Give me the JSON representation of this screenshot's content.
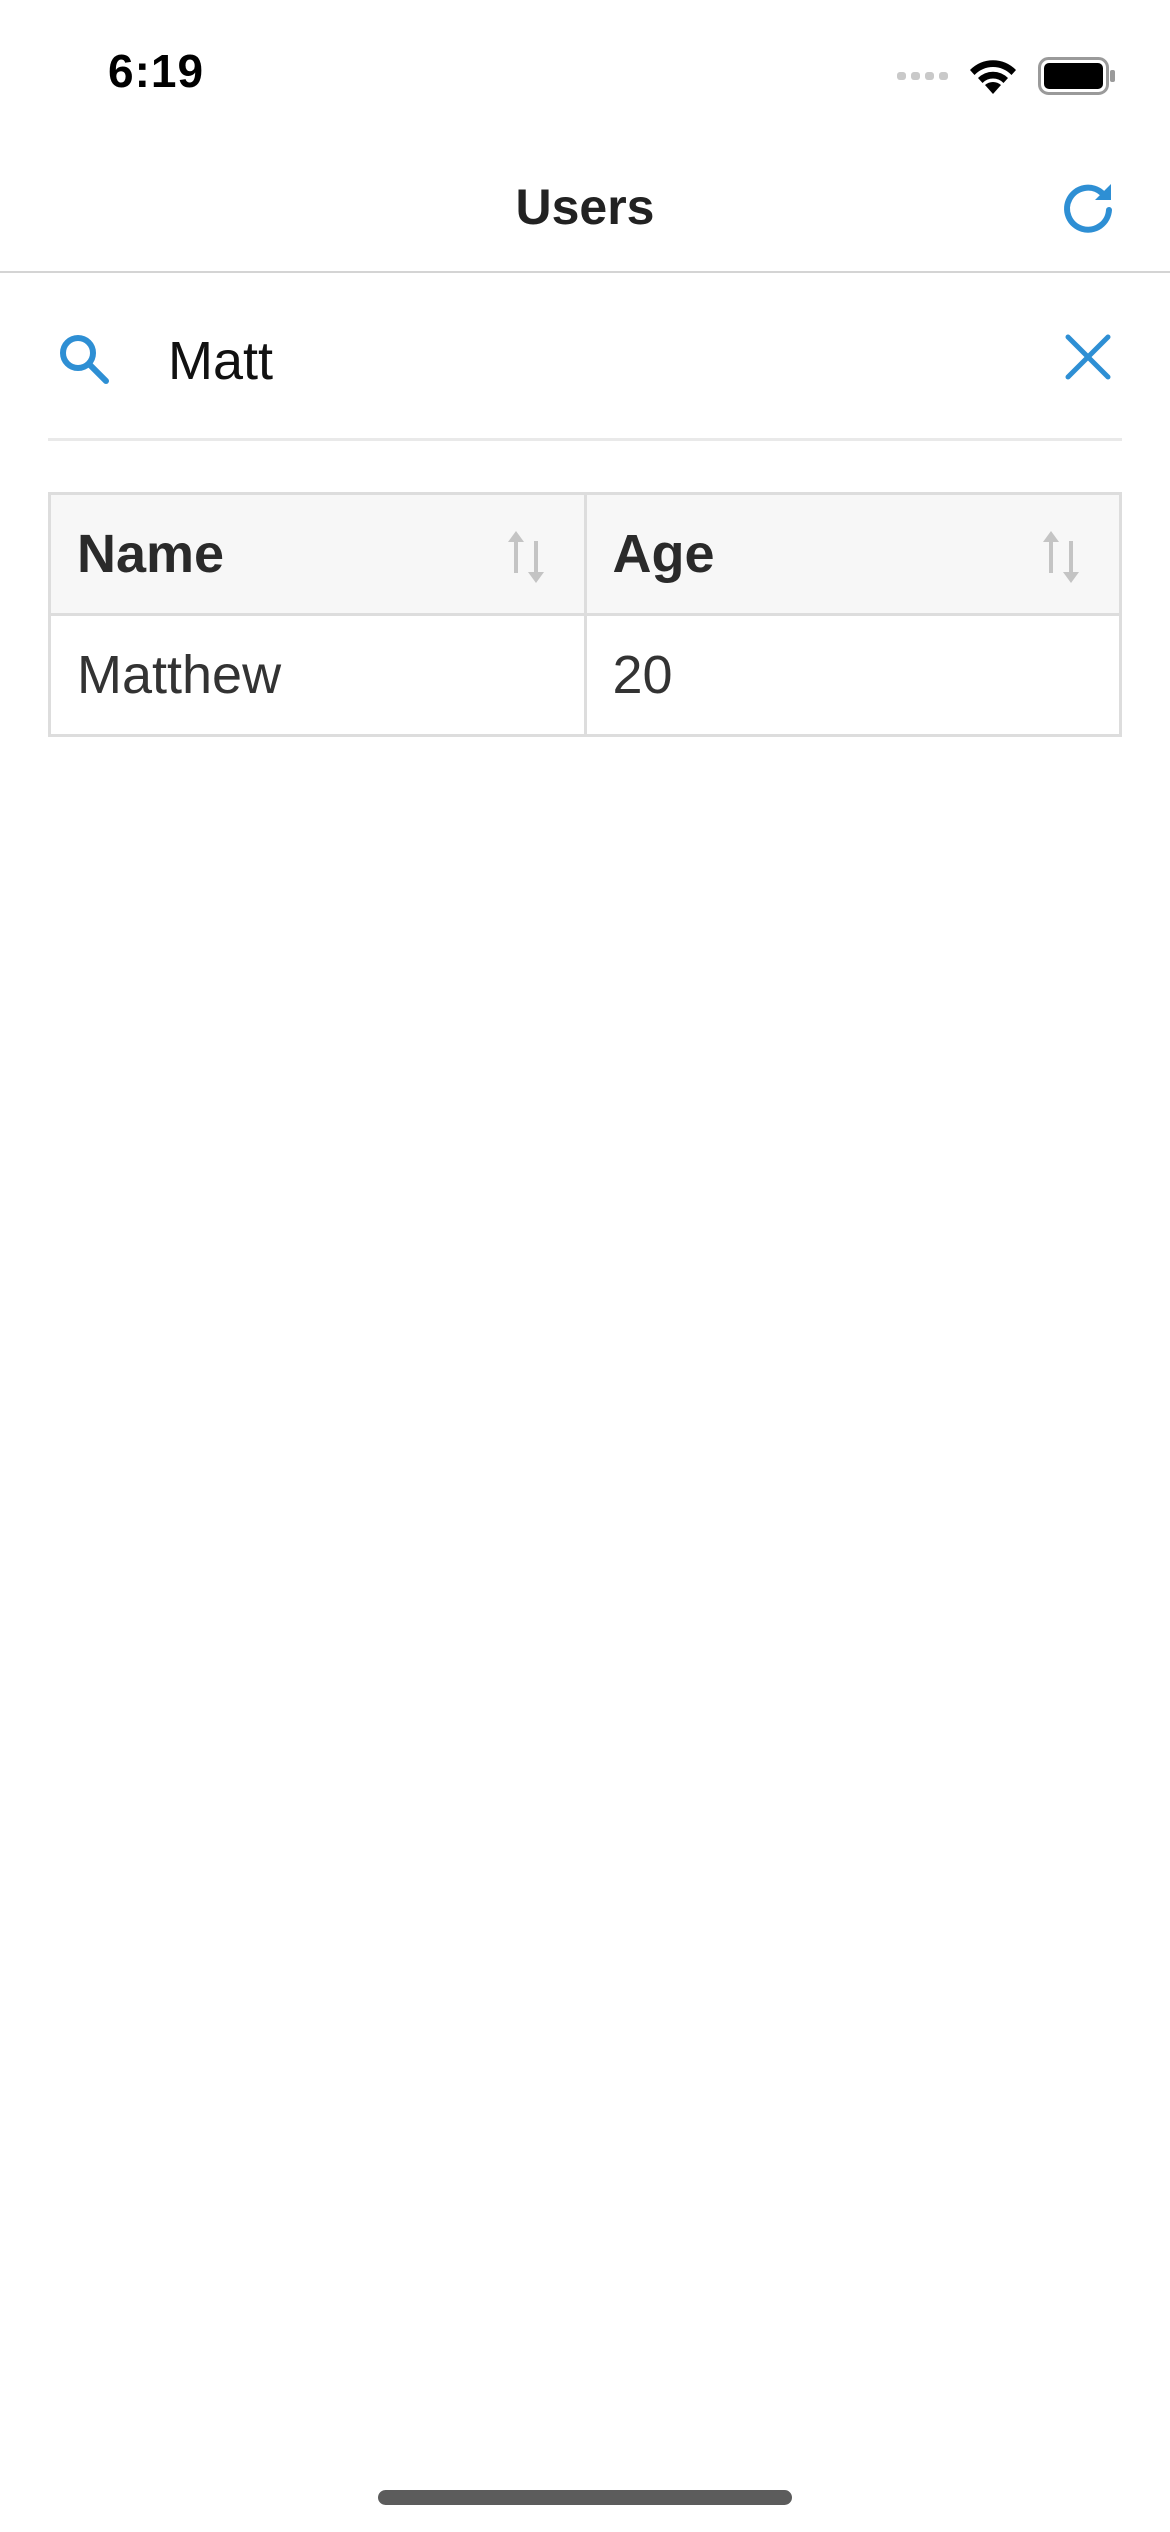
{
  "status_bar": {
    "time": "6:19"
  },
  "nav": {
    "title": "Users",
    "refresh_icon": "refresh-icon"
  },
  "search": {
    "value": "Matt",
    "search_icon": "search-icon",
    "clear_icon": "close-icon"
  },
  "table": {
    "columns": [
      {
        "label": "Name",
        "sort_icon": "sort-icon"
      },
      {
        "label": "Age",
        "sort_icon": "sort-icon"
      }
    ],
    "rows": [
      {
        "name": "Matthew",
        "age": "20"
      }
    ]
  },
  "colors": {
    "accent": "#2e8fd4",
    "header_bg": "#f7f7f7",
    "border": "#dddddd"
  }
}
